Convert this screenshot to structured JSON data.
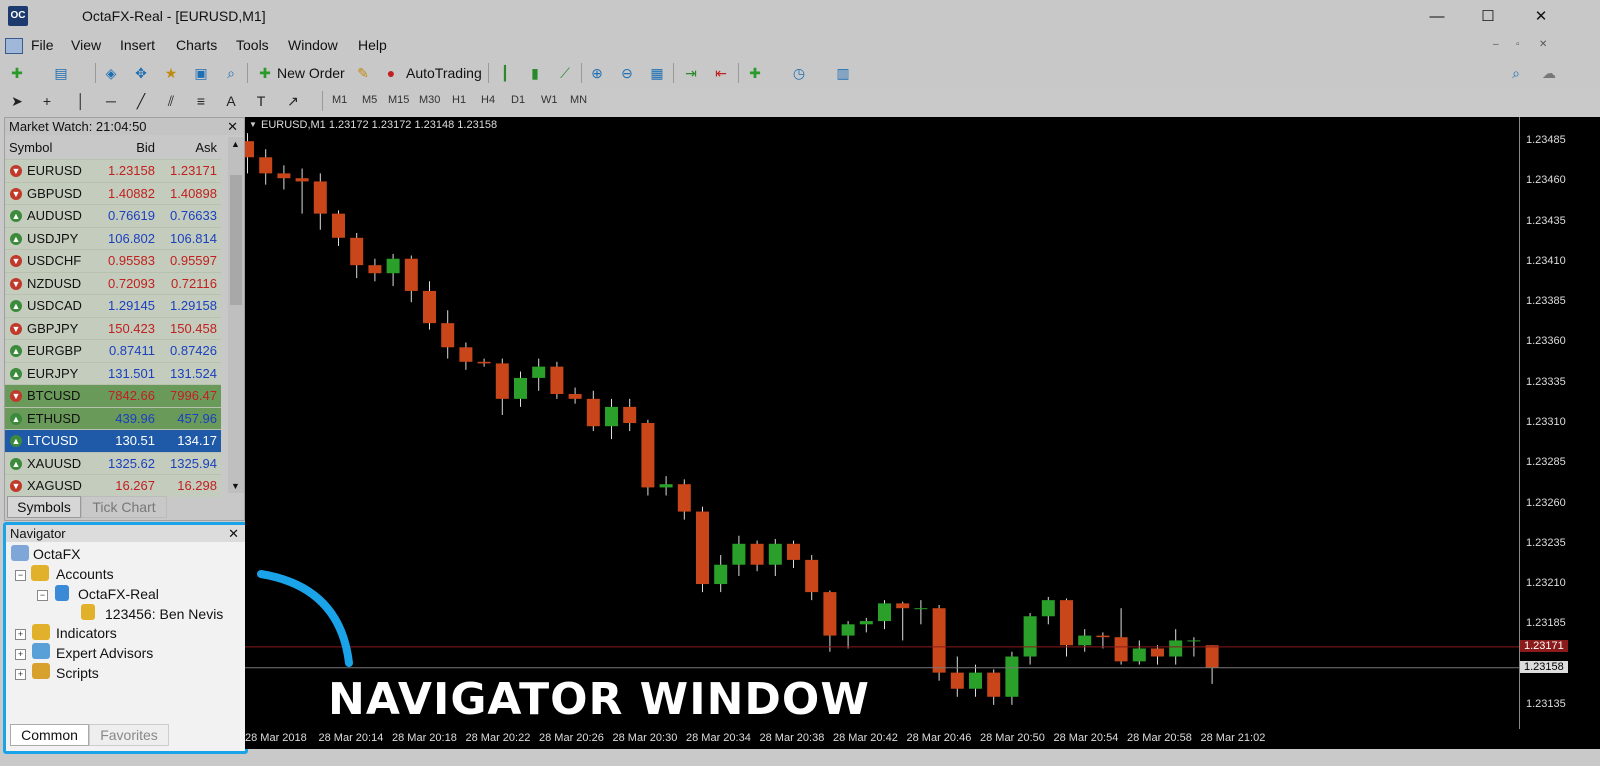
{
  "window": {
    "title": "OctaFX-Real - [EURUSD,M1]",
    "app_icon_text": "OC",
    "minimize": "—",
    "maximize": "☐",
    "close": "✕"
  },
  "menu": [
    "File",
    "View",
    "Insert",
    "Charts",
    "Tools",
    "Window",
    "Help"
  ],
  "toolbar": {
    "new_order": "New Order",
    "auto_trading": "AutoTrading"
  },
  "timeframes": [
    "M1",
    "M5",
    "M15",
    "M30",
    "H1",
    "H4",
    "D1",
    "W1",
    "MN"
  ],
  "market_watch": {
    "title": "Market Watch: 21:04:50",
    "close": "✕",
    "headers": {
      "symbol": "Symbol",
      "bid": "Bid",
      "ask": "Ask"
    },
    "rows": [
      {
        "symbol": "EURUSD",
        "bid": "1.23158",
        "ask": "1.23171",
        "dir": "down",
        "color": "red"
      },
      {
        "symbol": "GBPUSD",
        "bid": "1.40882",
        "ask": "1.40898",
        "dir": "down",
        "color": "red"
      },
      {
        "symbol": "AUDUSD",
        "bid": "0.76619",
        "ask": "0.76633",
        "dir": "up",
        "color": "blue"
      },
      {
        "symbol": "USDJPY",
        "bid": "106.802",
        "ask": "106.814",
        "dir": "up",
        "color": "blue"
      },
      {
        "symbol": "USDCHF",
        "bid": "0.95583",
        "ask": "0.95597",
        "dir": "down",
        "color": "red"
      },
      {
        "symbol": "NZDUSD",
        "bid": "0.72093",
        "ask": "0.72116",
        "dir": "down",
        "color": "red"
      },
      {
        "symbol": "USDCAD",
        "bid": "1.29145",
        "ask": "1.29158",
        "dir": "up",
        "color": "blue"
      },
      {
        "symbol": "GBPJPY",
        "bid": "150.423",
        "ask": "150.458",
        "dir": "down",
        "color": "red"
      },
      {
        "symbol": "EURGBP",
        "bid": "0.87411",
        "ask": "0.87426",
        "dir": "up",
        "color": "blue"
      },
      {
        "symbol": "EURJPY",
        "bid": "131.501",
        "ask": "131.524",
        "dir": "up",
        "color": "blue"
      },
      {
        "symbol": "BTCUSD",
        "bid": "7842.66",
        "ask": "7996.47",
        "dir": "down",
        "color": "red",
        "highlight": "green"
      },
      {
        "symbol": "ETHUSD",
        "bid": "439.96",
        "ask": "457.96",
        "dir": "up",
        "color": "blue",
        "highlight": "green"
      },
      {
        "symbol": "LTCUSD",
        "bid": "130.51",
        "ask": "134.17",
        "dir": "up",
        "color": "blue",
        "highlight": "selected"
      },
      {
        "symbol": "XAUUSD",
        "bid": "1325.62",
        "ask": "1325.94",
        "dir": "up",
        "color": "blue"
      },
      {
        "symbol": "XAGUSD",
        "bid": "16.267",
        "ask": "16.298",
        "dir": "down",
        "color": "red"
      }
    ],
    "tabs": [
      "Symbols",
      "Tick Chart"
    ]
  },
  "navigator": {
    "title": "Navigator",
    "close": "✕",
    "root": "OctaFX",
    "accounts": "Accounts",
    "account_server": "OctaFX-Real",
    "account_user": "123456: Ben Nevis",
    "indicators": "Indicators",
    "experts": "Expert Advisors",
    "scripts": "Scripts",
    "tabs": [
      "Common",
      "Favorites"
    ]
  },
  "chart": {
    "symbol_label": "EURUSD,M1  1.23172 1.23172 1.23148 1.23158",
    "price_ticks": [
      "1.23485",
      "1.23460",
      "1.23435",
      "1.23410",
      "1.23385",
      "1.23360",
      "1.23335",
      "1.23310",
      "1.23285",
      "1.23260",
      "1.23235",
      "1.23210",
      "1.23185",
      "1.23158",
      "1.23135"
    ],
    "ask_label": "1.23171",
    "bid_label": "1.23158",
    "time_ticks": [
      "28 Mar 2018",
      "28 Mar 20:14",
      "28 Mar 20:18",
      "28 Mar 20:22",
      "28 Mar 20:26",
      "28 Mar 20:30",
      "28 Mar 20:34",
      "28 Mar 20:38",
      "28 Mar 20:42",
      "28 Mar 20:46",
      "28 Mar 20:50",
      "28 Mar 20:54",
      "28 Mar 20:58",
      "28 Mar 21:02"
    ],
    "colors": {
      "bull": "#2aa02a",
      "bear": "#c8461a",
      "ask_line": "#8b1a1a",
      "bid_line": "#777777"
    }
  },
  "caption": "NAVIGATOR WINDOW",
  "accent": "#1aa3e8",
  "chart_data": {
    "type": "candlestick",
    "price_range": [
      1.2312,
      1.235
    ],
    "candles": [
      [
        1.23485,
        1.2349,
        1.23465,
        1.23475
      ],
      [
        1.23475,
        1.2348,
        1.23458,
        1.23465
      ],
      [
        1.23465,
        1.2347,
        1.23455,
        1.23462
      ],
      [
        1.23462,
        1.23468,
        1.2344,
        1.2346
      ],
      [
        1.2346,
        1.23465,
        1.2343,
        1.2344
      ],
      [
        1.2344,
        1.23442,
        1.2342,
        1.23425
      ],
      [
        1.23425,
        1.23428,
        1.234,
        1.23408
      ],
      [
        1.23408,
        1.23412,
        1.23398,
        1.23403
      ],
      [
        1.23403,
        1.23415,
        1.23395,
        1.23412
      ],
      [
        1.23412,
        1.23414,
        1.23385,
        1.23392
      ],
      [
        1.23392,
        1.23398,
        1.23368,
        1.23372
      ],
      [
        1.23372,
        1.2338,
        1.2335,
        1.23357
      ],
      [
        1.23357,
        1.2336,
        1.23343,
        1.23348
      ],
      [
        1.23348,
        1.2335,
        1.23345,
        1.23347
      ],
      [
        1.23347,
        1.2335,
        1.23315,
        1.23325
      ],
      [
        1.23325,
        1.23342,
        1.2332,
        1.23338
      ],
      [
        1.23338,
        1.2335,
        1.2333,
        1.23345
      ],
      [
        1.23345,
        1.23348,
        1.23325,
        1.23328
      ],
      [
        1.23328,
        1.23332,
        1.23322,
        1.23325
      ],
      [
        1.23325,
        1.2333,
        1.23305,
        1.23308
      ],
      [
        1.23308,
        1.23325,
        1.233,
        1.2332
      ],
      [
        1.2332,
        1.23325,
        1.23305,
        1.2331
      ],
      [
        1.2331,
        1.23312,
        1.23265,
        1.2327
      ],
      [
        1.2327,
        1.23277,
        1.23265,
        1.23272
      ],
      [
        1.23272,
        1.23275,
        1.2325,
        1.23255
      ],
      [
        1.23255,
        1.23258,
        1.23205,
        1.2321
      ],
      [
        1.2321,
        1.23228,
        1.23205,
        1.23222
      ],
      [
        1.23222,
        1.2324,
        1.23215,
        1.23235
      ],
      [
        1.23235,
        1.23237,
        1.23218,
        1.23222
      ],
      [
        1.23222,
        1.23238,
        1.23215,
        1.23235
      ],
      [
        1.23235,
        1.23237,
        1.2322,
        1.23225
      ],
      [
        1.23225,
        1.23228,
        1.232,
        1.23205
      ],
      [
        1.23205,
        1.23206,
        1.23168,
        1.23178
      ],
      [
        1.23178,
        1.23187,
        1.2317,
        1.23185
      ],
      [
        1.23185,
        1.23189,
        1.2318,
        1.23187
      ],
      [
        1.23187,
        1.232,
        1.23182,
        1.23198
      ],
      [
        1.23198,
        1.23199,
        1.23175,
        1.23195
      ],
      [
        1.23195,
        1.232,
        1.23185,
        1.23195
      ],
      [
        1.23195,
        1.23197,
        1.2315,
        1.23155
      ],
      [
        1.23155,
        1.23165,
        1.2314,
        1.23145
      ],
      [
        1.23145,
        1.2316,
        1.2314,
        1.23155
      ],
      [
        1.23155,
        1.23157,
        1.23135,
        1.2314
      ],
      [
        1.2314,
        1.23168,
        1.23135,
        1.23165
      ],
      [
        1.23165,
        1.23192,
        1.2316,
        1.2319
      ],
      [
        1.2319,
        1.23202,
        1.23185,
        1.232
      ],
      [
        1.232,
        1.23201,
        1.23165,
        1.23172
      ],
      [
        1.23172,
        1.23182,
        1.23168,
        1.23178
      ],
      [
        1.23178,
        1.2318,
        1.2317,
        1.23177
      ],
      [
        1.23177,
        1.23195,
        1.2316,
        1.23162
      ],
      [
        1.23162,
        1.23175,
        1.2316,
        1.2317
      ],
      [
        1.2317,
        1.23172,
        1.2316,
        1.23165
      ],
      [
        1.23165,
        1.23182,
        1.2316,
        1.23175
      ],
      [
        1.23175,
        1.23177,
        1.23165,
        1.23175
      ],
      [
        1.23172,
        1.23172,
        1.23148,
        1.23158
      ]
    ]
  }
}
